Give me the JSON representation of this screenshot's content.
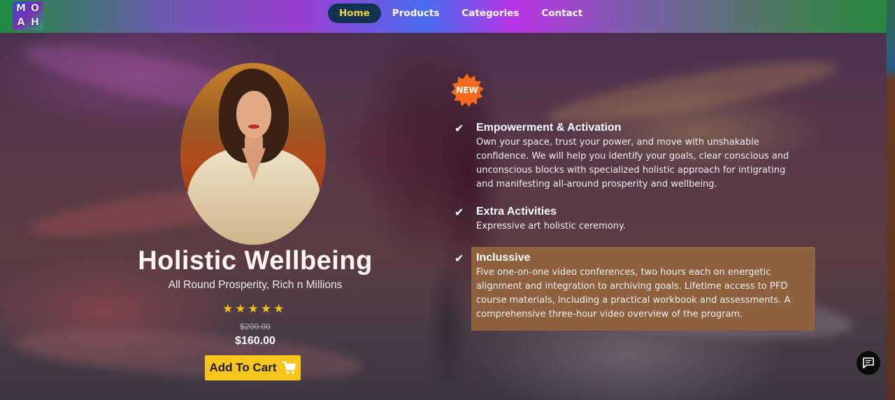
{
  "brand": {
    "logo_letters": [
      "M",
      "O",
      "A",
      "H"
    ]
  },
  "nav": {
    "items": [
      {
        "label": "Home",
        "active": true
      },
      {
        "label": "Products",
        "active": false
      },
      {
        "label": "Categories",
        "active": false
      },
      {
        "label": "Contact",
        "active": false
      }
    ]
  },
  "product": {
    "title": "Holistic Wellbeing",
    "subtitle": "All Round Prosperity, Rich n Millions",
    "rating": 5,
    "rating_max": 5,
    "original_price": "$200.00",
    "price": "$160.00",
    "add_to_cart_label": "Add To Cart",
    "badge": "NEW"
  },
  "features": [
    {
      "title": "Empowerment & Activation",
      "description": "Own your space, trust your power, and move with unshakable confidence. We will help you identify your goals, clear conscious and unconscious blocks with specialized holistic approach for intigrating and manifesting all-around prosperity and wellbeing."
    },
    {
      "title": "Extra Activities",
      "description": "Expressive art holistic ceremony."
    },
    {
      "title": "Inclussive",
      "description": "Five one-on-one video conferences, two hours each on energetic alignment and integration to archiving goals. Lifetime access to PFD course materials, including a practical workbook and assessments. A comprehensive three-hour video overview of the program."
    }
  ],
  "icons": {
    "check": "check-icon",
    "star": "star-icon",
    "cart": "cart-icon",
    "chat": "chat-icon"
  },
  "colors": {
    "accent_yellow": "#f7c51c",
    "nav_active_bg": "#0f3350",
    "nav_active_text": "#f3d33a",
    "badge_orange": "#f26a1b",
    "feature_highlight": "#8e623e"
  }
}
